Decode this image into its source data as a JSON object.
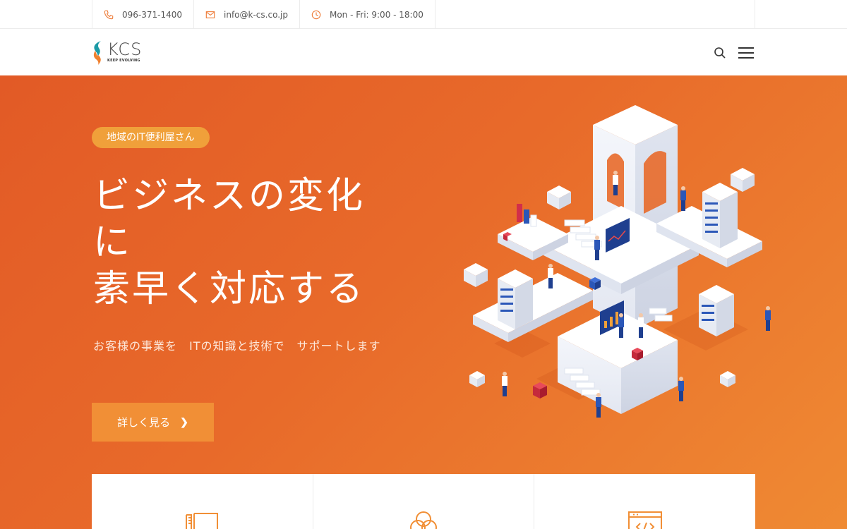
{
  "topbar": {
    "phone": "096-371-1400",
    "email": "info@k-cs.co.jp",
    "hours": "Mon - Fri: 9:00 - 18:00"
  },
  "header": {
    "logo_name": "KCS",
    "logo_tagline": "KEEP EVOLVING"
  },
  "hero": {
    "badge": "地域のIT便利屋さん",
    "headline_line1": "ビジネスの変化",
    "headline_line2": "に",
    "headline_line3": "素早く対応する",
    "subtext": "お客様の事業を　ITの知識と技術で　サポートします",
    "cta_label": "詳しく見る"
  },
  "colors": {
    "accent": "#f18f36",
    "hero_start": "#e25a26",
    "hero_end": "#ef8a33",
    "badge": "#f0a03a"
  },
  "icons": [
    "phone-icon",
    "mail-icon",
    "clock-icon",
    "search-icon",
    "hamburger-menu-icon",
    "book-icon",
    "circles-icon",
    "code-window-icon"
  ]
}
